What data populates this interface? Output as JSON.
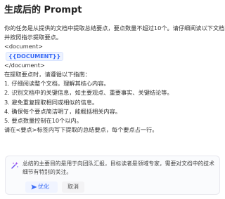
{
  "header": {
    "title": "生成后的 Prompt"
  },
  "prompt": {
    "intro_line_1": "你的任务是从提供的文档中提取总结要点，要点数量不超过10个。请仔细阅读以下文档，",
    "intro_line_2": "并按照指示提取要点。",
    "doc_open": "<document>",
    "doc_variable": "{{DOCUMENT}}",
    "doc_close": "</document>",
    "instruction_header": "在提取要点时，请遵循以下指南：",
    "steps": [
      "1. 仔细阅读整个文档，理解其核心内容。",
      "2. 识别文档中的关键信息，如主要观点、重要事实、关键结论等。",
      "3. 避免重复提取相同或相似的信息。",
      "4. 确保每个要点简洁明了，能概括相关内容。",
      "5. 要点数量控制在10个以内。"
    ],
    "output_instruction": "请在<要点>标签内写下提取的总结要点，每个要点占一行。"
  },
  "optimize": {
    "icon": "sparkle-icon",
    "suggestion": "总结的主要目的是用于向团队汇报，目标读者是领域专家，需要对文档中的技术细节有特别的关注。",
    "optimize_label": "优化",
    "cancel_label": "取消",
    "accent_color": "#3b6cf6"
  }
}
